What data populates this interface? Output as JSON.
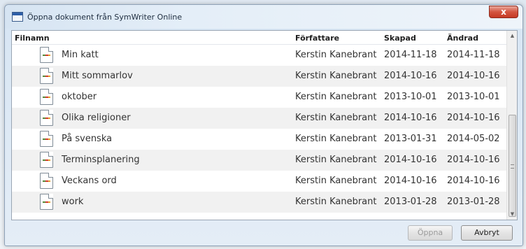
{
  "window": {
    "title": "Öppna dokument från SymWriter Online",
    "close_label": "x"
  },
  "table": {
    "columns": {
      "filename": "Filnamn",
      "author": "Författare",
      "created": "Skapad",
      "modified": "Ändrad"
    },
    "rows": [
      {
        "filename": "Min katt",
        "author": "Kerstin Kanebrant",
        "created": "2014-11-18",
        "modified": "2014-11-18"
      },
      {
        "filename": "Mitt sommarlov",
        "author": "Kerstin Kanebrant",
        "created": "2014-10-16",
        "modified": "2014-10-16"
      },
      {
        "filename": "oktober",
        "author": "Kerstin Kanebrant",
        "created": "2013-10-01",
        "modified": "2013-10-01"
      },
      {
        "filename": "Olika religioner",
        "author": "Kerstin Kanebrant",
        "created": "2014-10-16",
        "modified": "2014-10-16"
      },
      {
        "filename": "På svenska",
        "author": "Kerstin Kanebrant",
        "created": "2013-01-31",
        "modified": "2014-05-02"
      },
      {
        "filename": "Terminsplanering",
        "author": "Kerstin Kanebrant",
        "created": "2014-10-16",
        "modified": "2014-10-16"
      },
      {
        "filename": "Veckans ord",
        "author": "Kerstin Kanebrant",
        "created": "2014-10-16",
        "modified": "2014-10-16"
      },
      {
        "filename": "work",
        "author": "Kerstin Kanebrant",
        "created": "2013-01-28",
        "modified": "2013-01-28"
      }
    ]
  },
  "buttons": {
    "open_label": "Öppna",
    "cancel_label": "Avbryt"
  },
  "icons": {
    "file": "document-icon",
    "app": "app-window-icon"
  },
  "colors": {
    "close_button": "#c53a24",
    "row_alt": "#f1f1f1"
  }
}
